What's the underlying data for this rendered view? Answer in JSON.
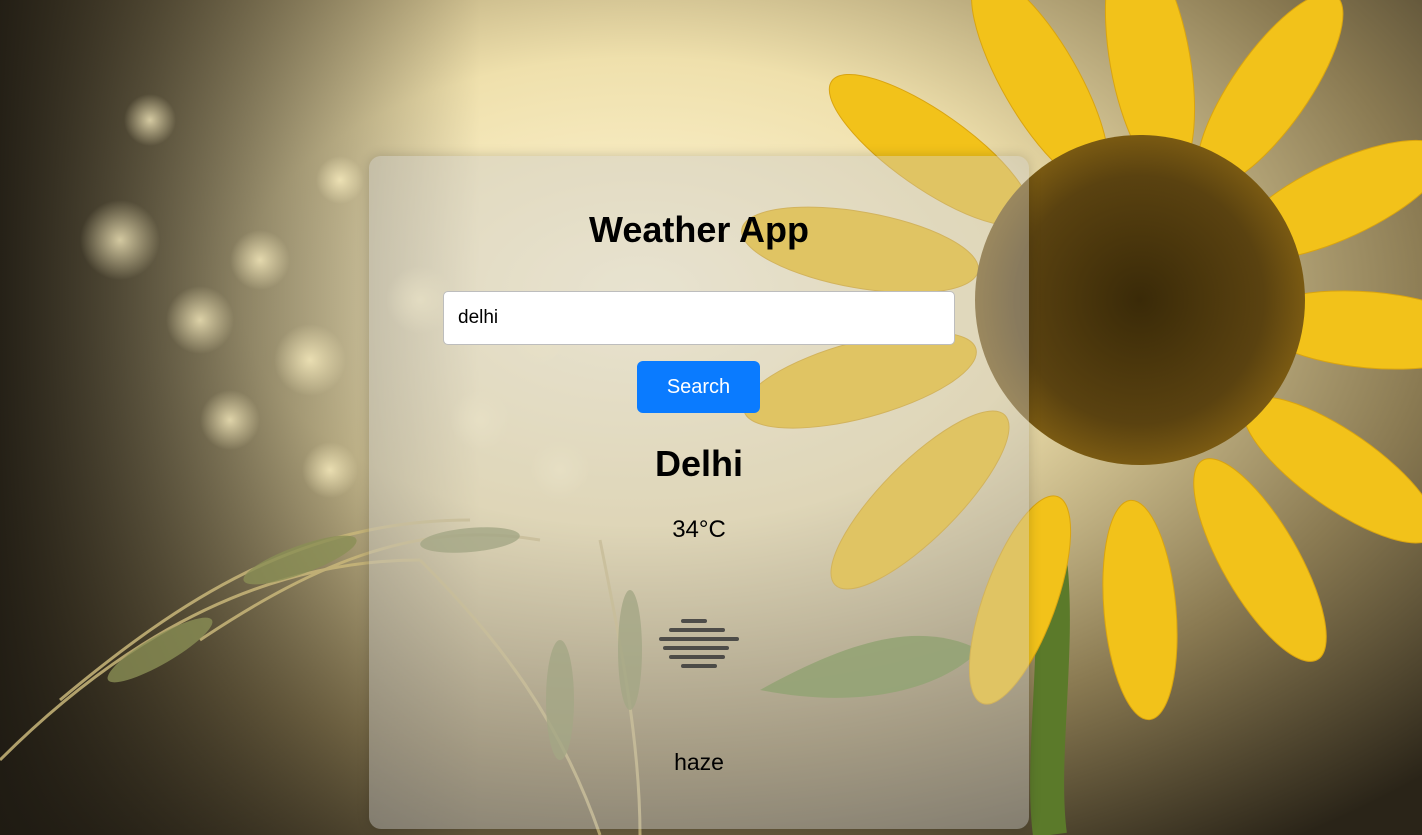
{
  "app": {
    "title": "Weather App"
  },
  "search": {
    "value": "delhi",
    "button_label": "Search"
  },
  "weather": {
    "city": "Delhi",
    "temperature": "34°C",
    "description": "haze",
    "icon": "haze-icon"
  },
  "colors": {
    "button": "#0a7bff",
    "card": "rgba(200,200,200,0.42)"
  }
}
